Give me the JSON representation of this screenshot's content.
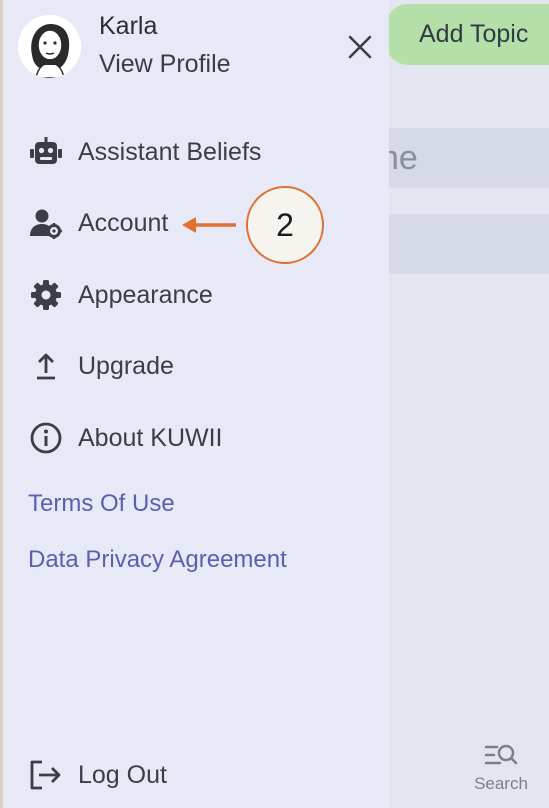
{
  "background": {
    "add_topic_label": "Add Topic",
    "input_partial_text": "ne",
    "search_label": "Search"
  },
  "profile": {
    "name": "Karla",
    "view_profile_label": "View Profile"
  },
  "menu": {
    "items": [
      {
        "label": "Assistant Beliefs",
        "icon": "robot-icon"
      },
      {
        "label": "Account",
        "icon": "user-gear-icon"
      },
      {
        "label": "Appearance",
        "icon": "gear-icon"
      },
      {
        "label": "Upgrade",
        "icon": "upload-arrow-icon"
      },
      {
        "label": "About KUWII",
        "icon": "info-icon"
      }
    ],
    "links": [
      {
        "label": "Terms Of Use"
      },
      {
        "label": "Data Privacy Agreement"
      }
    ],
    "logout_label": "Log Out"
  },
  "annotation": {
    "number": "2",
    "color": "#e07131"
  },
  "colors": {
    "drawer_bg": "#e8e9f6",
    "link": "#5b5fb0",
    "add_topic_bg": "#b5dfa8"
  }
}
